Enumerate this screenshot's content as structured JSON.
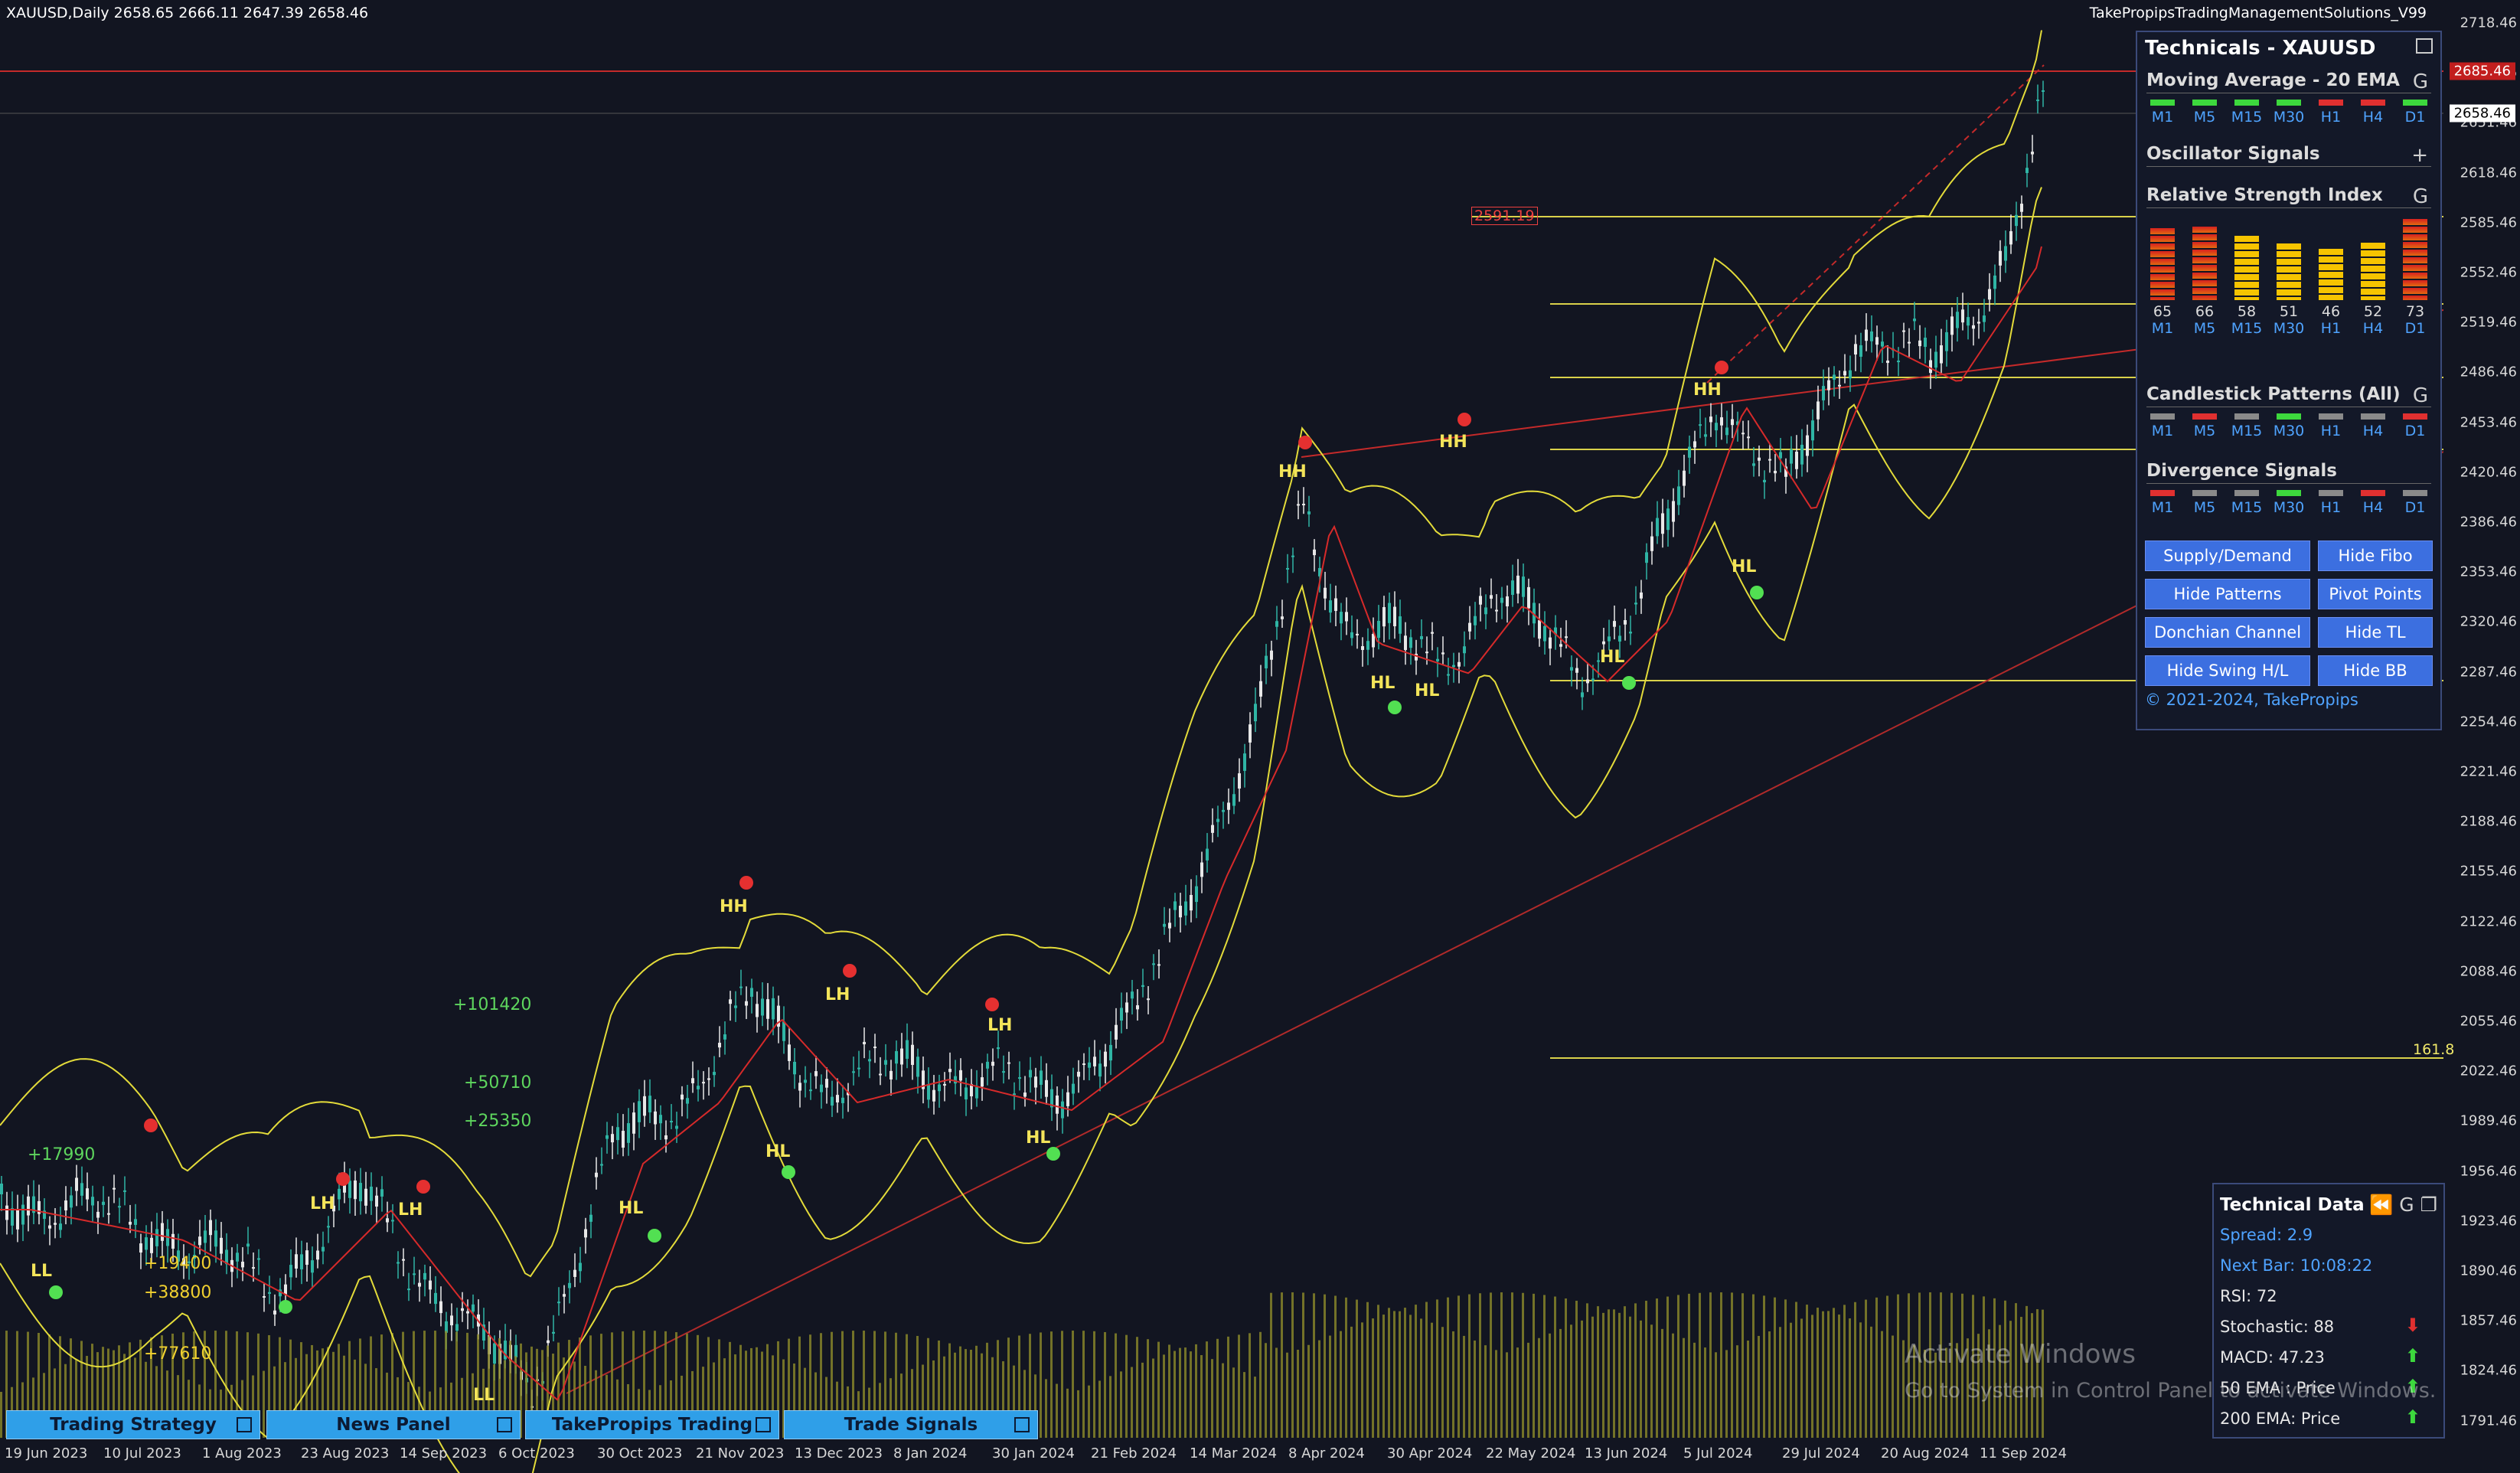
{
  "header": {
    "symbol_line": "XAUUSD,Daily  2658.65 2666.11 2647.39 2658.46",
    "indicator_name": "TakePropipsTradingManagementSolutions_V99"
  },
  "price_axis": {
    "labels": [
      "2718.46",
      "2685.46",
      "2651.46",
      "2618.46",
      "2585.46",
      "2552.46",
      "2519.46",
      "2486.46",
      "2453.46",
      "2420.46",
      "2386.46",
      "2353.46",
      "2320.46",
      "2287.46",
      "2254.46",
      "2221.46",
      "2188.46",
      "2155.46",
      "2122.46",
      "2088.46",
      "2055.46",
      "2022.46",
      "1989.46",
      "1956.46",
      "1923.46",
      "1890.46",
      "1857.46",
      "1824.46",
      "1791.46"
    ],
    "current_price_tag": "2658.46",
    "resistance_tag": "2685.46",
    "fib_level_tag": "2591.19",
    "fib_extension": "161.8"
  },
  "date_axis": [
    "19 Jun 2023",
    "10 Jul 2023",
    "1 Aug 2023",
    "23 Aug 2023",
    "14 Sep 2023",
    "6 Oct 2023",
    "30 Oct 2023",
    "21 Nov 2023",
    "13 Dec 2023",
    "8 Jan 2024",
    "30 Jan 2024",
    "21 Feb 2024",
    "14 Mar 2024",
    "8 Apr 2024",
    "30 Apr 2024",
    "22 May 2024",
    "13 Jun 2024",
    "5 Jul 2024",
    "29 Jul 2024",
    "20 Aug 2024",
    "11 Sep 2024"
  ],
  "chart_annotations": {
    "swing_labels": [
      "HH",
      "HH",
      "HH",
      "HH",
      "LH",
      "LH",
      "LH",
      "LH",
      "LL",
      "LL",
      "HL",
      "HL",
      "HL",
      "HL",
      "HL",
      "HL",
      "HL"
    ],
    "left_values": [
      "+17990",
      "+19400",
      "+38800",
      "+77610",
      "+101420",
      "+50710",
      "+25350"
    ]
  },
  "technicals_panel": {
    "title": "Technicals - XAUUSD",
    "moving_average": {
      "title": "Moving Average - 20 EMA",
      "icon": "G",
      "timeframes": [
        "M1",
        "M5",
        "M15",
        "M30",
        "H1",
        "H4",
        "D1"
      ],
      "colors": [
        "#3dd83d",
        "#3dd83d",
        "#3dd83d",
        "#3dd83d",
        "#e03030",
        "#e03030",
        "#3dd83d"
      ]
    },
    "oscillator": {
      "title": "Oscillator Signals",
      "icon": "+"
    },
    "rsi": {
      "title": "Relative Strength Index",
      "icon": "G",
      "timeframes": [
        "M1",
        "M5",
        "M15",
        "M30",
        "H1",
        "H4",
        "D1"
      ],
      "values": [
        "65",
        "66",
        "58",
        "51",
        "46",
        "52",
        "73"
      ],
      "levels": [
        65,
        66,
        58,
        51,
        46,
        52,
        73
      ]
    },
    "candlestick": {
      "title": "Candlestick Patterns (All)",
      "icon": "G",
      "timeframes": [
        "M1",
        "M5",
        "M15",
        "M30",
        "H1",
        "H4",
        "D1"
      ],
      "colors": [
        "#8a8a8a",
        "#e03030",
        "#8a8a8a",
        "#3dd83d",
        "#8a8a8a",
        "#8a8a8a",
        "#e03030"
      ]
    },
    "divergence": {
      "title": "Divergence Signals",
      "timeframes": [
        "M1",
        "M5",
        "M15",
        "M30",
        "H1",
        "H4",
        "D1"
      ],
      "colors": [
        "#e03030",
        "#8a8a8a",
        "#8a8a8a",
        "#3dd83d",
        "#8a8a8a",
        "#e03030",
        "#8a8a8a"
      ]
    },
    "buttons": [
      "Supply/Demand",
      "Hide Fibo",
      "Hide Patterns",
      "Pivot Points",
      "Donchian Channel",
      "Hide TL",
      "Hide Swing H/L",
      "Hide BB"
    ],
    "copyright": "© 2021-2024, TakePropips"
  },
  "technical_data": {
    "title": "Technical Data",
    "spread": "Spread: 2.9",
    "next_bar": "Next Bar: 10:08:22",
    "rsi": "RSI: 72",
    "stochastic": "Stochastic: 88",
    "macd": "MACD:  47.23",
    "ema50": "50 EMA : Price",
    "ema200": "200 EMA: Price"
  },
  "bottom_tabs": [
    "Trading Strategy",
    "News Panel",
    "TakePropips Trading",
    "Trade Signals"
  ],
  "watermark": {
    "title": "Activate Windows",
    "subtitle": "Go to System in Control Panel to activate Windows."
  }
}
